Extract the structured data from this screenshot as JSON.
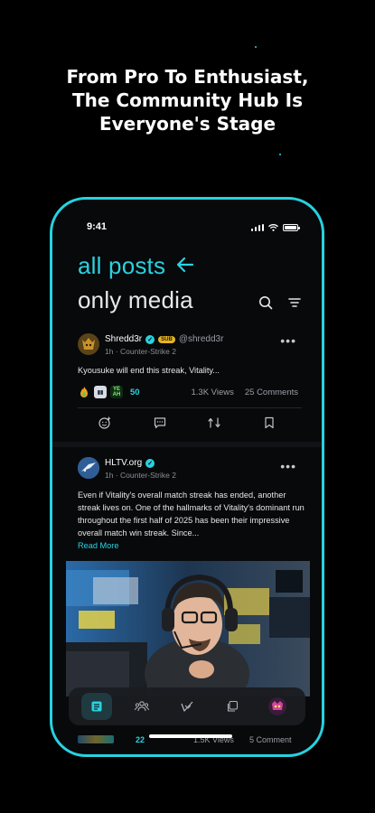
{
  "promo": {
    "headline_lines": [
      "From Pro To Enthusiast,",
      "The Community Hub Is",
      "Everyone's Stage"
    ]
  },
  "status_bar": {
    "time": "9:41"
  },
  "tabs": [
    {
      "label": "all posts",
      "active": true
    },
    {
      "label": "only media",
      "active": false
    }
  ],
  "posts": [
    {
      "username": "Shredd3r",
      "badge": "SUB",
      "handle": "@shredd3r",
      "time": "1h",
      "game": "Counter-Strike 2",
      "text": "Kyousuke will end this streak, Vitality...",
      "emotes": [
        "fire",
        "cards",
        "yeah"
      ],
      "emote_yeah_label": "YE\nAH",
      "reactions": "50",
      "views": "1.3K Views",
      "comments": "25 Comments"
    },
    {
      "username": "HLTV.org",
      "time": "1h",
      "game": "Counter-Strike 2",
      "text": "Even if Vitality's overall match streak has ended, another streak lives on. One of the hallmarks of Vitality's dominant run throughout the first half of 2025 has been their impressive overall match win streak. Since...",
      "read_more": "Read More",
      "reactions": "22",
      "views": "1.5K Views",
      "comments": "5 Comment"
    }
  ],
  "meta_separator": " · ",
  "bottom_nav": [
    "posts-icon",
    "community-icon",
    "vote-icon",
    "copy-icon",
    "profile-icon"
  ],
  "colors": {
    "accent": "#27d2e0",
    "background": "#000000",
    "sub_badge": "#e6b422"
  }
}
